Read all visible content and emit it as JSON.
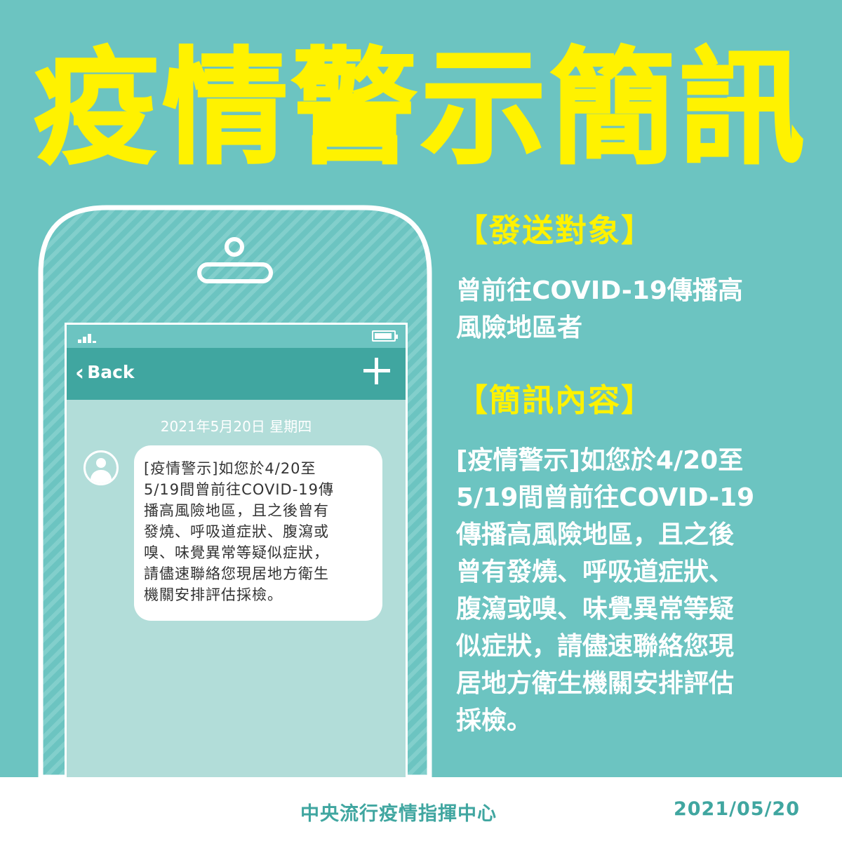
{
  "title": "疫情警示簡訊",
  "phone": {
    "back_label": "Back",
    "date": "2021年5月20日 星期四",
    "message_lines": [
      "[疫情警示]如您於4/20至",
      "5/19間曾前往COVID-19傳",
      "播高風險地區，且之後曾有",
      "發燒、呼吸道症狀、腹瀉或",
      "嗅、味覺異常等疑似症狀，",
      "請儘速聯絡您現居地方衛生",
      "機關安排評估採檢。"
    ]
  },
  "recipients": {
    "heading": "【發送對象】",
    "lines": [
      "曾前往COVID-19傳播高",
      "風險地區者"
    ]
  },
  "content": {
    "heading": "【簡訊內容】",
    "lines": [
      "[疫情警示]如您於4/20至",
      "5/19間曾前往COVID-19",
      "傳播高風險地區，且之後",
      "曾有發燒、呼吸道症狀、",
      "腹瀉或嗅、味覺異常等疑",
      "似症狀，請儘速聯絡您現",
      "居地方衛生機關安排評估",
      "採檢。"
    ]
  },
  "footer": {
    "organization": "中央流行疫情指揮中心",
    "date": "2021/05/20"
  },
  "colors": {
    "background": "#6cc4c1",
    "accent_yellow": "#fff200",
    "nav_teal": "#40a6a0",
    "screen": "#b2ddd9"
  },
  "icons": [
    "signal-icon",
    "battery-icon",
    "chevron-left-icon",
    "plus-icon",
    "avatar-icon"
  ]
}
